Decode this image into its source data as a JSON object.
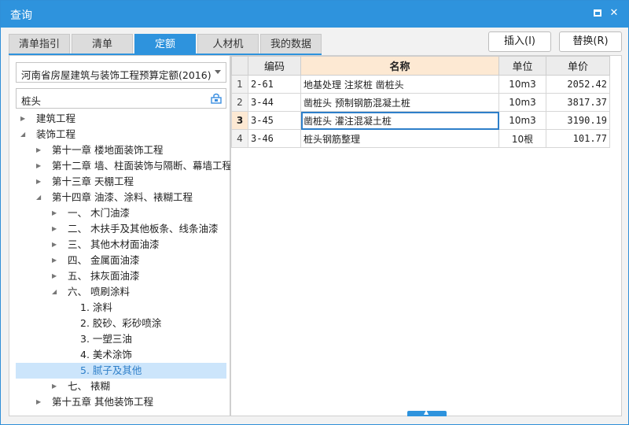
{
  "window": {
    "title": "查询",
    "max_glyph": "",
    "close_glyph": "✕"
  },
  "tabs": [
    {
      "label": "清单指引"
    },
    {
      "label": "清单"
    },
    {
      "label": "定额",
      "active": true
    },
    {
      "label": "人材机"
    },
    {
      "label": "我的数据"
    }
  ],
  "actions": {
    "insert_label": "插入(I)",
    "replace_label": "替换(R)"
  },
  "left": {
    "quota_select_value": "河南省房屋建筑与装饰工程预算定额(2016)",
    "search_value": "桩头",
    "tree": [
      {
        "label": "建筑工程",
        "level": 0,
        "expander": "collapsed"
      },
      {
        "label": "装饰工程",
        "level": 0,
        "expander": "expanded"
      },
      {
        "label": "第十一章 楼地面装饰工程",
        "level": 1,
        "expander": "collapsed"
      },
      {
        "label": "第十二章 墙、柱面装饰与隔断、幕墙工程",
        "level": 1,
        "expander": "collapsed"
      },
      {
        "label": "第十三章 天棚工程",
        "level": 1,
        "expander": "collapsed"
      },
      {
        "label": "第十四章 油漆、涂料、裱糊工程",
        "level": 1,
        "expander": "expanded"
      },
      {
        "label": "一、  木门油漆",
        "level": 2,
        "expander": "collapsed"
      },
      {
        "label": "二、  木扶手及其他板条、线条油漆",
        "level": 2,
        "expander": "collapsed"
      },
      {
        "label": "三、  其他木材面油漆",
        "level": 2,
        "expander": "collapsed"
      },
      {
        "label": "四、  金属面油漆",
        "level": 2,
        "expander": "collapsed"
      },
      {
        "label": "五、  抹灰面油漆",
        "level": 2,
        "expander": "collapsed"
      },
      {
        "label": "六、  喷刷涂料",
        "level": 2,
        "expander": "expanded"
      },
      {
        "label": "1. 涂料",
        "level": 3,
        "expander": "none"
      },
      {
        "label": "2. 胶砂、彩砂喷涂",
        "level": 3,
        "expander": "none"
      },
      {
        "label": "3. 一塑三油",
        "level": 3,
        "expander": "none"
      },
      {
        "label": "4. 美术涂饰",
        "level": 3,
        "expander": "none"
      },
      {
        "label": "5. 腻子及其他",
        "level": 3,
        "expander": "none",
        "selected": true
      },
      {
        "label": "七、  裱糊",
        "level": 2,
        "expander": "collapsed"
      },
      {
        "label": "第十五章 其他装饰工程",
        "level": 1,
        "expander": "collapsed"
      }
    ]
  },
  "grid": {
    "headers": {
      "code": "编码",
      "name": "名称",
      "unit": "单位",
      "price": "单价"
    },
    "rows": [
      {
        "no": "1",
        "code": "2-61",
        "name": "地基处理 注浆桩 凿桩头",
        "unit": "10m3",
        "price": "2052.42"
      },
      {
        "no": "2",
        "code": "3-44",
        "name": "凿桩头 预制钢筋混凝土桩",
        "unit": "10m3",
        "price": "3817.37"
      },
      {
        "no": "3",
        "code": "3-45",
        "name": "凿桩头 灌注混凝土桩",
        "unit": "10m3",
        "price": "3190.19",
        "current": true
      },
      {
        "no": "4",
        "code": "3-46",
        "name": "桩头钢筋整理",
        "unit": "10根",
        "price": "101.77"
      }
    ]
  },
  "colors": {
    "accent": "#2e93dd",
    "selected_row": "#cce5fb",
    "header_highlight": "#fde9d3"
  }
}
